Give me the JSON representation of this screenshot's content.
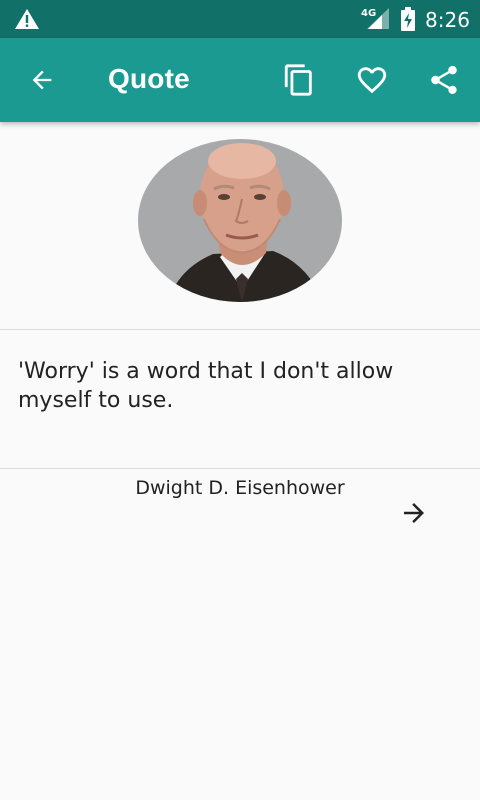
{
  "status_bar": {
    "network_label": "4G",
    "time": "8:26",
    "icons": [
      "warning-icon",
      "signal-icon",
      "battery-charging-icon"
    ]
  },
  "app_bar": {
    "title": "Quote",
    "actions": [
      "back-arrow-icon",
      "copy-icon",
      "heart-icon",
      "share-icon"
    ],
    "color": "#1a9a91"
  },
  "quote": {
    "text": "'Worry' is a word that I don't allow myself to use.",
    "author": "Dwight D. Eisenhower"
  },
  "colors": {
    "status_bar": "#117068",
    "app_bar": "#1a9a91",
    "background": "#fafafa",
    "text": "#222222"
  }
}
